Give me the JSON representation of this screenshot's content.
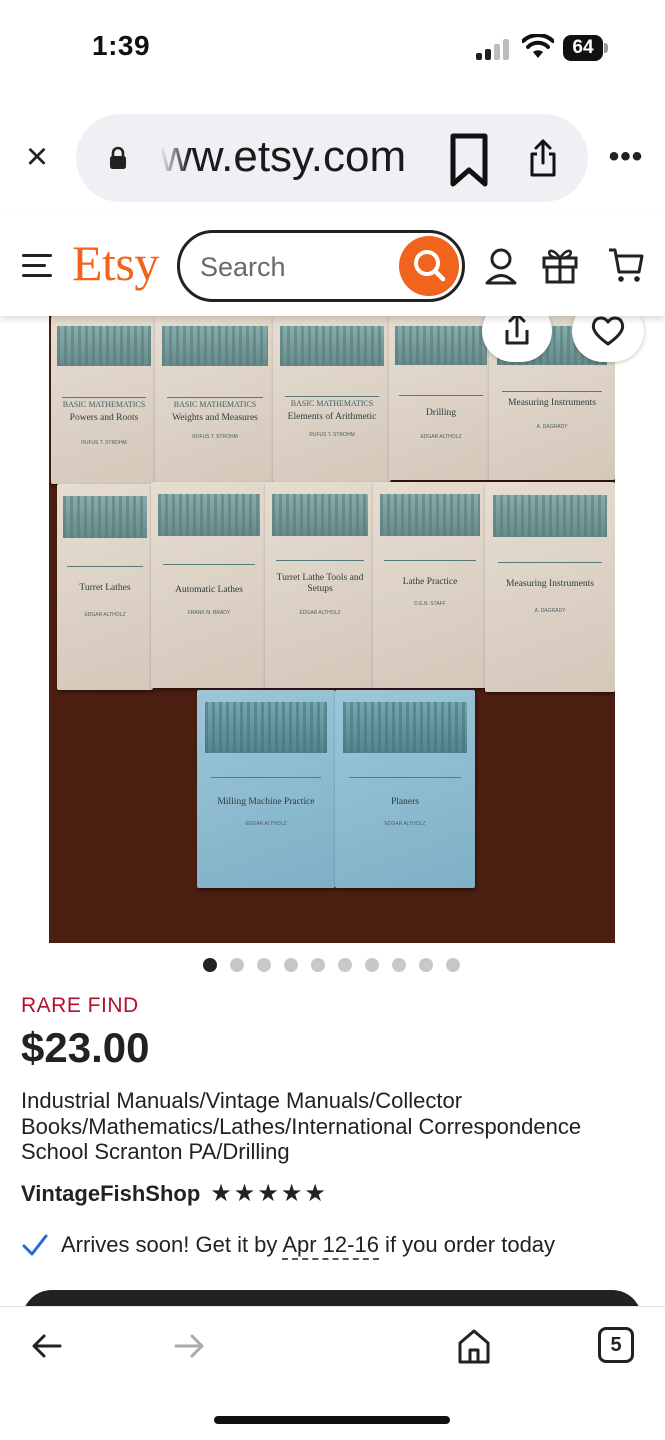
{
  "status_bar": {
    "time": "1:39",
    "battery": "64",
    "icons": [
      "signal-icon",
      "wifi-icon",
      "battery-icon"
    ]
  },
  "browser": {
    "url": "ww.etsy.com",
    "icons": [
      "close-icon",
      "lock-icon",
      "bookmark-icon",
      "share-icon",
      "more-icon"
    ],
    "more_label": "•••"
  },
  "etsy_header": {
    "logo": "Etsy",
    "search": {
      "placeholder": "Search",
      "value": ""
    },
    "icons": [
      "menu-icon",
      "search-icon",
      "user-icon",
      "gift-icon",
      "cart-icon"
    ],
    "brand_color": "#f1641e"
  },
  "listing_image": {
    "books_row1": [
      {
        "series": "BASIC MATHEMATICS",
        "title": "Powers and Roots",
        "author": "RUFUS T. STROHM"
      },
      {
        "series": "BASIC MATHEMATICS",
        "title": "Weights and Measures",
        "author": "RUFUS T. STROHM"
      },
      {
        "series": "BASIC MATHEMATICS",
        "title": "Elements of Arithmetic",
        "author": "RUFUS T. STROHM"
      },
      {
        "series": "",
        "title": "Drilling",
        "author": "EDGAR ALTHOLZ"
      },
      {
        "series": "",
        "title": "Measuring Instruments",
        "author": "A. DAGRADY"
      }
    ],
    "books_row2": [
      {
        "title": "Turret Lathes",
        "author": "EDGAR ALTHOLZ"
      },
      {
        "title": "Automatic Lathes",
        "author": "FRANK M. BRADY"
      },
      {
        "title": "Turret Lathe Tools and Setups",
        "author": "EDGAR ALTHOLZ"
      },
      {
        "title": "Lathe Practice",
        "author": "D.E.N. STAFF"
      },
      {
        "title": "Measuring Instruments",
        "author": "A. DAGRADY"
      }
    ],
    "books_row3": [
      {
        "title": "Milling Machine Practice",
        "author": "EDGAR ALTHOLZ"
      },
      {
        "title": "Planers",
        "author": "EDGAR ALTHOLZ"
      }
    ],
    "icons": [
      "share-icon",
      "heart-icon"
    ]
  },
  "carousel": {
    "count": 10,
    "active": 0
  },
  "listing": {
    "badge": "RARE FIND",
    "price": "$23.00",
    "title": "Industrial Manuals/Vintage Manuals/Collector Books/Mathematics/Lathes/International Correspondence School Scranton PA/Drilling",
    "shop_name": "VintageFishShop",
    "rating_stars": 5,
    "arrival_prefix": "Arrives soon! Get it by ",
    "arrival_date": "Apr 12-16",
    "arrival_suffix": " if you order today"
  },
  "bottom_bar": {
    "tab_count": "5",
    "icons": [
      "back-arrow-icon",
      "forward-arrow-icon",
      "home-icon",
      "tabs-icon"
    ]
  }
}
